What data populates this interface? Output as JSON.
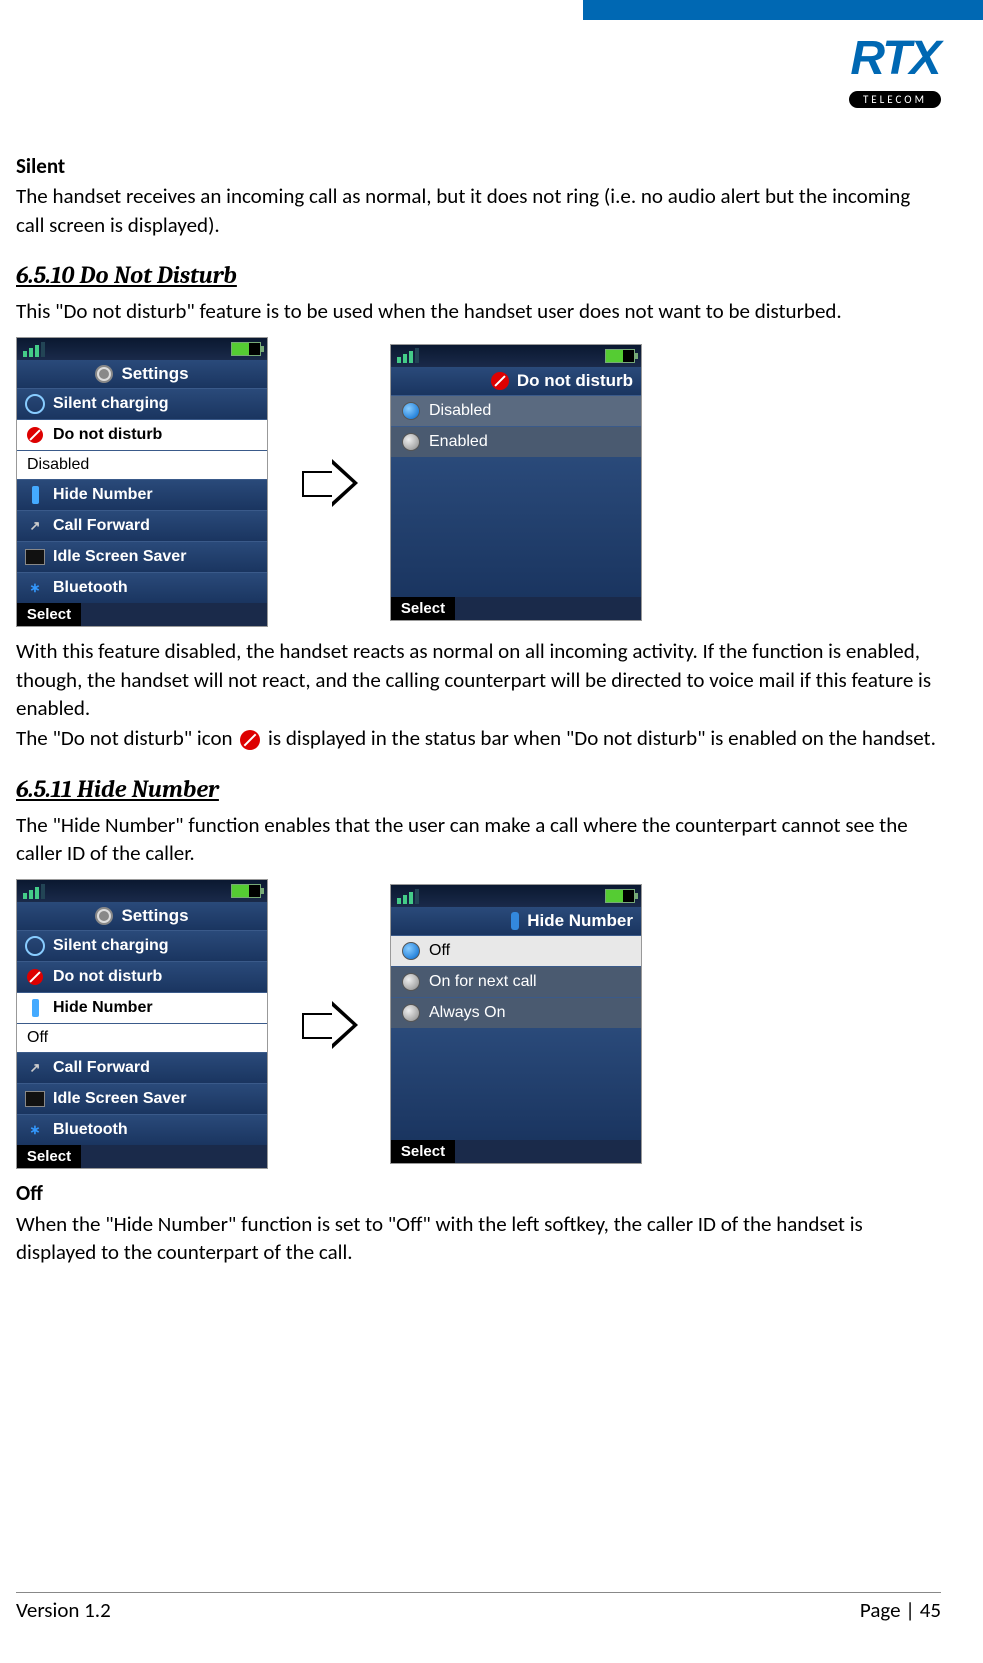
{
  "header": {
    "logo_main": "RTX",
    "logo_sub": "TELECOM"
  },
  "silent": {
    "title": "Silent",
    "body": "The handset receives an incoming call as normal, but it does not ring (i.e. no audio alert but the incoming call screen is displayed)."
  },
  "s6510": {
    "heading": "6.5.10 Do Not Disturb",
    "intro": "This \"Do not disturb\" feature is to be used when the handset user does not want to be disturbed.",
    "after_p1": "With this feature disabled, the handset reacts as normal on all incoming activity. If the function is enabled, though, the handset will not react, and the calling counterpart will be directed to voice mail if this feature is enabled.",
    "after_p2a": "The \"Do not disturb\" icon ",
    "after_p2b": " is displayed in the status bar when \"Do not disturb\" is enabled on the handset."
  },
  "s6511": {
    "heading": "6.5.11 Hide Number",
    "intro": "The \"Hide Number\" function enables that the user can make a call where the counterpart cannot see the caller ID of the caller.",
    "off_title": "Off",
    "off_body": "When the \"Hide Number\" function is set to \"Off\" with the left softkey, the caller ID of the handset is displayed to the counterpart of the call."
  },
  "screens": {
    "settings_title": "Settings",
    "dnd_title": "Do not disturb",
    "hide_title": "Hide Number",
    "softkey_select": "Select",
    "settings_items": {
      "silent_charging": "Silent charging",
      "dnd": "Do not disturb",
      "dnd_value": "Disabled",
      "hide": "Hide Number",
      "hide_value": "Off",
      "fwd": "Call Forward",
      "saver": "Idle Screen Saver",
      "bt": "Bluetooth"
    },
    "dnd_options": {
      "disabled": "Disabled",
      "enabled": "Enabled"
    },
    "hide_options": {
      "off": "Off",
      "next": "On for next call",
      "always": "Always On"
    }
  },
  "footer": {
    "version": "Version 1.2",
    "page": "Page | 45"
  }
}
